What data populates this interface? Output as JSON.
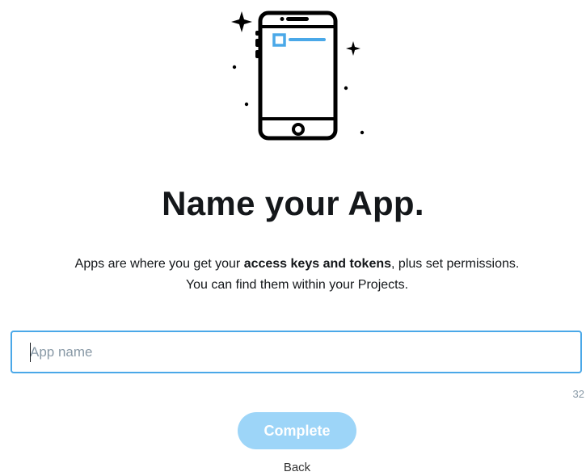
{
  "dialog": {
    "title": "Name your App.",
    "description": {
      "before": "Apps are where you get your ",
      "bold": "access keys and tokens",
      "after": ", plus set permissions.",
      "line2": "You can find them within your Projects."
    },
    "app_name_input": {
      "value": "",
      "placeholder": "App name",
      "counter": "32"
    },
    "complete_label": "Complete",
    "back_label": "Back"
  },
  "colors": {
    "input_border": "#4aa8e8",
    "button_disabled": "#9dd5f8",
    "illustration_accent": "#4aa8e8"
  },
  "icons": {
    "illustration": "smartphone-icon",
    "sparkle": "sparkle-icon"
  }
}
